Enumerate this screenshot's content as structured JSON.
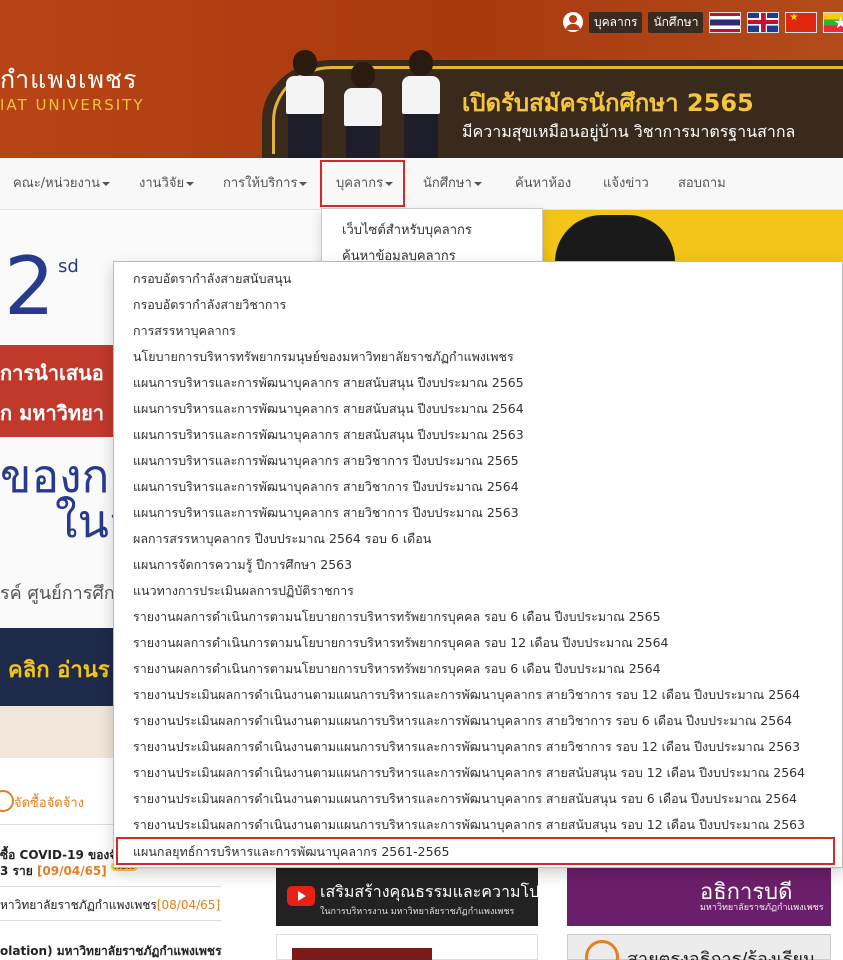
{
  "header": {
    "logo_th": "กำแพงเพชร",
    "logo_en": "IAT UNIVERSITY",
    "banner_title": "เปิดรับสมัครนักศึกษา 2565",
    "banner_subtitle": "มีความสุขเหมือนอยู่บ้าน วิชาการมาตรฐานสากล",
    "tools": {
      "staff_label": "บุคลากร",
      "student_label": "นักศึกษา"
    },
    "flags": [
      "thai-flag-icon",
      "uk-flag-icon",
      "china-flag-icon",
      "myanmar-flag-icon"
    ]
  },
  "navbar": {
    "items": [
      {
        "label": "คณะ/หน่วยงาน",
        "caret": true
      },
      {
        "label": "งานวิจัย",
        "caret": true
      },
      {
        "label": "การให้บริการ",
        "caret": true
      },
      {
        "label": "บุคลากร",
        "caret": true,
        "active": true
      },
      {
        "label": "นักศึกษา",
        "caret": true
      },
      {
        "label": "ค้นหาห้อง",
        "caret": false
      },
      {
        "label": "แจ้งข่าว",
        "caret": false
      },
      {
        "label": "สอบถาม",
        "caret": false
      }
    ]
  },
  "dropdown": {
    "items": [
      "เว็บไซต์สำหรับบุคลากร",
      "ค้นหาข้อมูลบุคลากร"
    ]
  },
  "submenu": {
    "items": [
      "กรอบอัตรากำลังสายสนับสนุน",
      "กรอบอัตรากำลังสายวิชาการ",
      "การสรรหาบุคลากร",
      "นโยบายการบริหารทรัพยากรมนุษย์ของมหาวิทยาลัยราชภัฏกำแพงเพชร",
      "แผนการบริหารและการพัฒนาบุคลากร สายสนับสนุน ปีงบประมาณ 2565",
      "แผนการบริหารและการพัฒนาบุคลากร สายสนับสนุน ปีงบประมาณ 2564",
      "แผนการบริหารและการพัฒนาบุคลากร สายสนับสนุน ปีงบประมาณ 2563",
      "แผนการบริหารและการพัฒนาบุคลากร สายวิชาการ ปีงบประมาณ 2565",
      "แผนการบริหารและการพัฒนาบุคลากร สายวิชาการ ปีงบประมาณ 2564",
      "แผนการบริหารและการพัฒนาบุคลากร สายวิชาการ ปีงบประมาณ 2563",
      "ผลการสรรหาบุคลากร ปีงบประมาณ 2564 รอบ 6 เดือน",
      "แผนการจัดการความรู้ ปีการศึกษา 2563",
      "แนวทางการประเมินผลการปฏิบัติราชการ",
      "รายงานผลการดำเนินการตามนโยบายการบริหารทรัพยากรบุคคล รอบ 6 เดือน ปีงบประมาณ 2565",
      "รายงานผลการดำเนินการตามนโยบายการบริหารทรัพยากรบุคคล รอบ 12 เดือน ปีงบประมาณ 2564",
      "รายงานผลการดำเนินการตามนโยบายการบริหารทรัพยากรบุคคล รอบ 6 เดือน ปีงบประมาณ 2564",
      "รายงานประเมินผลการดำเนินงานตามแผนการบริหารและการพัฒนาบุคลากร สายวิชาการ รอบ 12 เดือน ปีงบประมาณ 2564",
      "รายงานประเมินผลการดำเนินงานตามแผนการบริหารและการพัฒนาบุคลากร สายวิชาการ รอบ 6 เดือน ปีงบประมาณ 2564",
      "รายงานประเมินผลการดำเนินงานตามแผนการบริหารและการพัฒนาบุคลากร สายวิชาการ รอบ 12 เดือน ปีงบประมาณ 2563",
      "รายงานประเมินผลการดำเนินงานตามแผนการบริหารและการพัฒนาบุคลากร สายสนับสนุน รอบ 12 เดือน ปีงบประมาณ 2564",
      "รายงานประเมินผลการดำเนินงานตามแผนการบริหารและการพัฒนาบุคลากร สายสนับสนุน รอบ 6 เดือน ปีงบประมาณ 2564",
      "รายงานประเมินผลการดำเนินงานตามแผนการบริหารและการพัฒนาบุคลากร สายสนับสนุน รอบ 12 เดือน ปีงบประมาณ 2563",
      "แผนกลยุทธ์การบริหารและการพัฒนาบุคลากร 2561-2565"
    ]
  },
  "background": {
    "hero_number": "2",
    "hero_sup": "sd",
    "hero_band_line1": "การนำเสนอ",
    "hero_band_line2": "ก มหาวิทยา",
    "hero_big1": "ของก",
    "hero_big2": "ในส",
    "hero_small": "รค์ ศูนย์การศึก",
    "click_banner": "คลิก อ่านร",
    "procure_label": "จัดซื้อจัดจ้าง",
    "news": [
      {
        "text": "ซื้อ COVID-19 ของจั",
        "date": ""
      },
      {
        "text": "3 ราย",
        "date": "[09/04/65]",
        "new_badge": "NEW"
      },
      {
        "text": "หาวิทยาลัยราชภัฏกำแพงเพชร",
        "date": "[08/04/65]"
      },
      {
        "text": "olation) มหาวิทยาลัยราชภัฏกำแพงเพชร",
        "date": ""
      }
    ],
    "mid_banner_title": "เสริมสร้างคุณธรรมและความโปร่งใส",
    "mid_banner_sub": "ในการบริหารงาน มหาวิทยาลัยราชภัฏกำแพงเพชร",
    "right_banner_title": "อธิการบดี",
    "right_banner_sub": "มหาวิทยาลัยราชภัฏกำแพงเพชร",
    "right_box_text": "สายตรงอธิการ/ร้องเรียน"
  },
  "colors": {
    "header_bg": "#b43f12",
    "banner_gold": "#f5c542",
    "nav_bg": "#f8f8f8",
    "highlight_red": "#d42a2a",
    "accent_orange": "#e67e22"
  }
}
